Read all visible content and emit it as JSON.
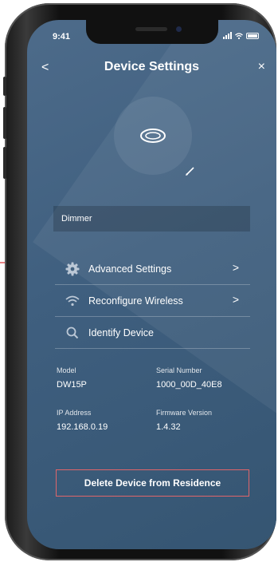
{
  "status_bar": {
    "time": "9:41"
  },
  "header": {
    "back": "<",
    "title": "Device Settings",
    "close": "×"
  },
  "device_name": "Dimmer",
  "menu": [
    {
      "label": "Advanced Settings",
      "icon": "gear-icon",
      "chevron": ">"
    },
    {
      "label": "Reconfigure Wireless",
      "icon": "wifi-icon",
      "chevron": ">"
    },
    {
      "label": "Identify Device",
      "icon": "search-icon",
      "chevron": ""
    }
  ],
  "info": {
    "model_label": "Model",
    "model_value": "DW15P",
    "serial_label": "Serial Number",
    "serial_value": "1000_00D_40E8",
    "ip_label": "IP Address",
    "ip_value": "192.168.0.19",
    "firmware_label": "Firmware Version",
    "firmware_value": "1.4.32"
  },
  "delete_label": "Delete Device from Residence",
  "colors": {
    "screen_bg": "#3f5f7f",
    "delete_border": "#e0656a",
    "arrow": "#d9383a"
  }
}
